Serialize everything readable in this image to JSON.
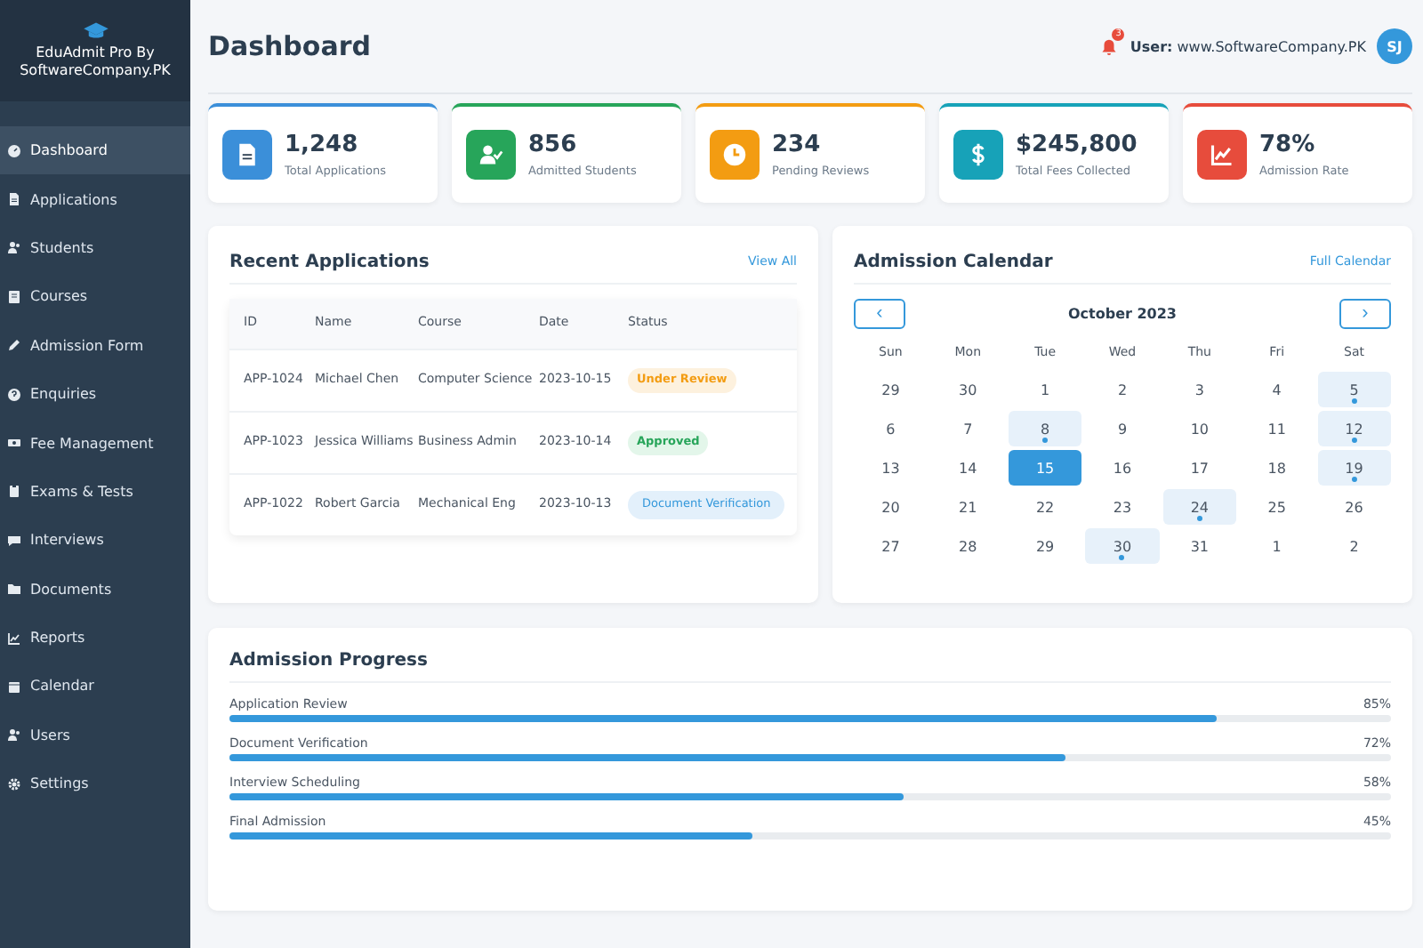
{
  "sidebar": {
    "brand": "EduAdmit Pro By SoftwareCompany.PK",
    "items": [
      {
        "label": "Dashboard",
        "kind": "gauge",
        "selected": true
      },
      {
        "label": "Applications",
        "kind": "file",
        "selected": false
      },
      {
        "label": "Students",
        "kind": "users",
        "selected": false
      },
      {
        "label": "Courses",
        "kind": "book",
        "selected": false
      },
      {
        "label": "Admission Form",
        "kind": "edit",
        "selected": false
      },
      {
        "label": "Enquiries",
        "kind": "question",
        "selected": false
      },
      {
        "label": "Fee Management",
        "kind": "money",
        "selected": false
      },
      {
        "label": "Exams & Tests",
        "kind": "clipboard",
        "selected": false
      },
      {
        "label": "Interviews",
        "kind": "chat",
        "selected": false
      },
      {
        "label": "Documents",
        "kind": "folder",
        "selected": false
      },
      {
        "label": "Reports",
        "kind": "chart",
        "selected": false
      },
      {
        "label": "Calendar",
        "kind": "calendar",
        "selected": false
      },
      {
        "label": "Users",
        "kind": "users",
        "selected": false
      },
      {
        "label": "Settings",
        "kind": "gear",
        "selected": false
      }
    ]
  },
  "header": {
    "title": "Dashboard",
    "notification_count": "3",
    "user_label": "User:",
    "user_name": "www.SoftwareCompany.PK",
    "avatar": "SJ"
  },
  "stats": [
    {
      "value": "1,248",
      "label": "Total Applications",
      "kind": "file",
      "color": "#3b8fd9"
    },
    {
      "value": "856",
      "label": "Admitted Students",
      "kind": "user-check",
      "color": "#27a55a"
    },
    {
      "value": "234",
      "label": "Pending Reviews",
      "kind": "clock",
      "color": "#f39c12"
    },
    {
      "value": "$245,800",
      "label": "Total Fees Collected",
      "kind": "dollar",
      "color": "#17a2b8"
    },
    {
      "value": "78%",
      "label": "Admission Rate",
      "kind": "chart",
      "color": "#e74c3c"
    }
  ],
  "recent_applications": {
    "title": "Recent Applications",
    "link": "View All",
    "columns": [
      "ID",
      "Name",
      "Course",
      "Date",
      "Status"
    ],
    "rows": [
      {
        "id": "APP-1024",
        "name": "Michael Chen",
        "course": "Computer Science",
        "date": "2023-10-15",
        "status": "Under Review",
        "kind": "review"
      },
      {
        "id": "APP-1023",
        "name": "Jessica Williams",
        "course": "Business Admin",
        "date": "2023-10-14",
        "status": "Approved",
        "kind": "approved"
      },
      {
        "id": "APP-1022",
        "name": "Robert Garcia",
        "course": "Mechanical Eng",
        "date": "2023-10-13",
        "status": "Document Verification",
        "kind": "document"
      }
    ]
  },
  "calendar": {
    "title": "Admission Calendar",
    "link": "Full Calendar",
    "prev": "‹",
    "next": "›",
    "month": "October 2023",
    "weekdays": [
      "Sun",
      "Mon",
      "Tue",
      "Wed",
      "Thu",
      "Fri",
      "Sat"
    ],
    "weeks": [
      [
        {
          "day": "29",
          "event": false,
          "selected": false
        },
        {
          "day": "30",
          "event": false,
          "selected": false
        },
        {
          "day": "1",
          "event": false,
          "selected": false
        },
        {
          "day": "2",
          "event": false,
          "selected": false
        },
        {
          "day": "3",
          "event": false,
          "selected": false
        },
        {
          "day": "4",
          "event": false,
          "selected": false
        },
        {
          "day": "5",
          "event": true,
          "selected": false
        }
      ],
      [
        {
          "day": "6",
          "event": false,
          "selected": false
        },
        {
          "day": "7",
          "event": false,
          "selected": false
        },
        {
          "day": "8",
          "event": true,
          "selected": false
        },
        {
          "day": "9",
          "event": false,
          "selected": false
        },
        {
          "day": "10",
          "event": false,
          "selected": false
        },
        {
          "day": "11",
          "event": false,
          "selected": false
        },
        {
          "day": "12",
          "event": true,
          "selected": false
        }
      ],
      [
        {
          "day": "13",
          "event": false,
          "selected": false
        },
        {
          "day": "14",
          "event": false,
          "selected": false
        },
        {
          "day": "15",
          "event": false,
          "selected": true
        },
        {
          "day": "16",
          "event": false,
          "selected": false
        },
        {
          "day": "17",
          "event": false,
          "selected": false
        },
        {
          "day": "18",
          "event": false,
          "selected": false
        },
        {
          "day": "19",
          "event": true,
          "selected": false
        }
      ],
      [
        {
          "day": "20",
          "event": false,
          "selected": false
        },
        {
          "day": "21",
          "event": false,
          "selected": false
        },
        {
          "day": "22",
          "event": false,
          "selected": false
        },
        {
          "day": "23",
          "event": false,
          "selected": false
        },
        {
          "day": "24",
          "event": true,
          "selected": false
        },
        {
          "day": "25",
          "event": false,
          "selected": false
        },
        {
          "day": "26",
          "event": false,
          "selected": false
        }
      ],
      [
        {
          "day": "27",
          "event": false,
          "selected": false
        },
        {
          "day": "28",
          "event": false,
          "selected": false
        },
        {
          "day": "29",
          "event": false,
          "selected": false
        },
        {
          "day": "30",
          "event": true,
          "selected": false
        },
        {
          "day": "31",
          "event": false,
          "selected": false
        },
        {
          "day": "1",
          "event": false,
          "selected": false
        },
        {
          "day": "2",
          "event": false,
          "selected": false
        }
      ]
    ]
  },
  "progress": {
    "title": "Admission Progress",
    "items": [
      {
        "label": "Application Review",
        "reading": "85%",
        "level": 0.85
      },
      {
        "label": "Document Verification",
        "reading": "72%",
        "level": 0.72
      },
      {
        "label": "Interview Scheduling",
        "reading": "58%",
        "level": 0.58
      },
      {
        "label": "Final Admission",
        "reading": "45%",
        "level": 0.45
      }
    ]
  }
}
